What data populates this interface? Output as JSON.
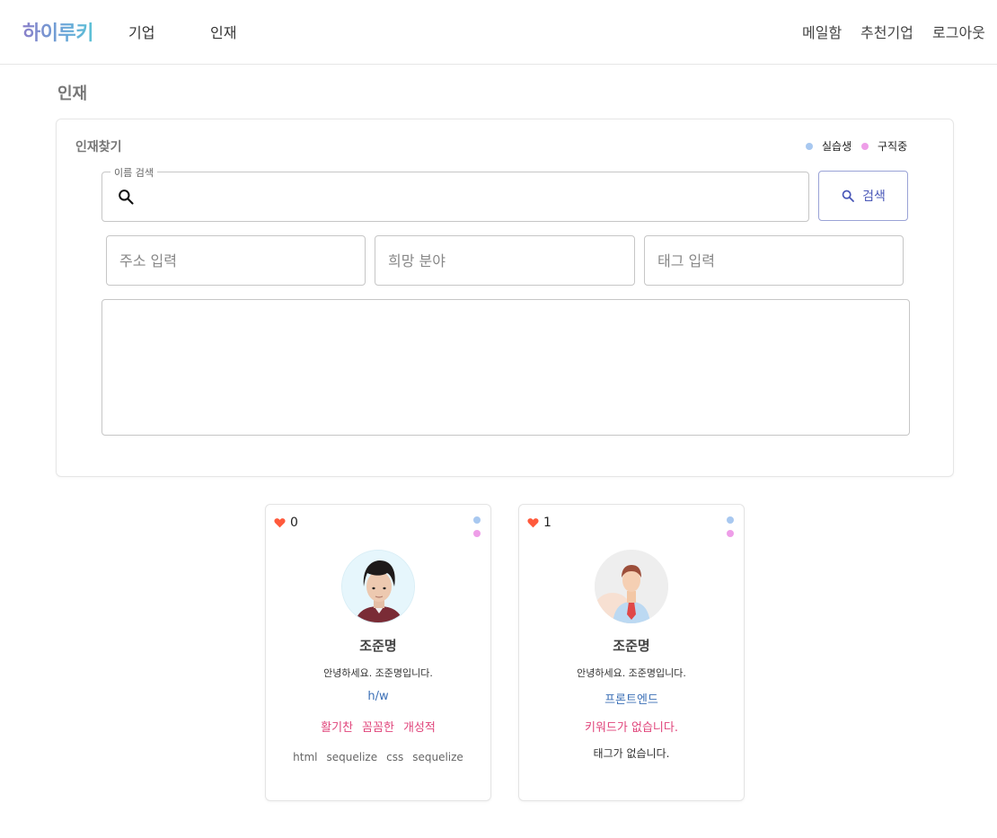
{
  "header": {
    "logo": "하이루키",
    "nav_left": [
      "기업",
      "인재"
    ],
    "nav_right": [
      "메일함",
      "추천기업",
      "로그아웃"
    ]
  },
  "page": {
    "title": "인재"
  },
  "search_panel": {
    "title": "인재찾기",
    "legend": [
      {
        "label": "실습생",
        "color": "#a8c8f0"
      },
      {
        "label": "구직중",
        "color": "#ee9ee8"
      }
    ],
    "name_label": "이름 검색",
    "name_value": "",
    "search_button": "검색",
    "address_placeholder": "주소 입력",
    "field_placeholder": "희망 분야",
    "tag_placeholder": "태그 입력"
  },
  "cards": [
    {
      "likes": "0",
      "name": "조준명",
      "intro": "안녕하세요. 조준명입니다.",
      "field": "h/w",
      "keywords": [
        "활기찬",
        "꼼꼼한",
        "개성적"
      ],
      "tags": [
        "html",
        "sequelize",
        "css",
        "sequelize"
      ],
      "avatar": "photo-avatar"
    },
    {
      "likes": "1",
      "name": "조준명",
      "intro": "안녕하세요. 조준명입니다.",
      "field": "프론트엔드",
      "keywords_empty": "키워드가 없습니다.",
      "tags_empty": "태그가 없습니다.",
      "avatar": "default-avatar"
    }
  ],
  "colors": {
    "accent": "#4a58b8",
    "heart": "#ff5a3c",
    "keyword": "#e0457b",
    "field": "#3b6fb6"
  }
}
